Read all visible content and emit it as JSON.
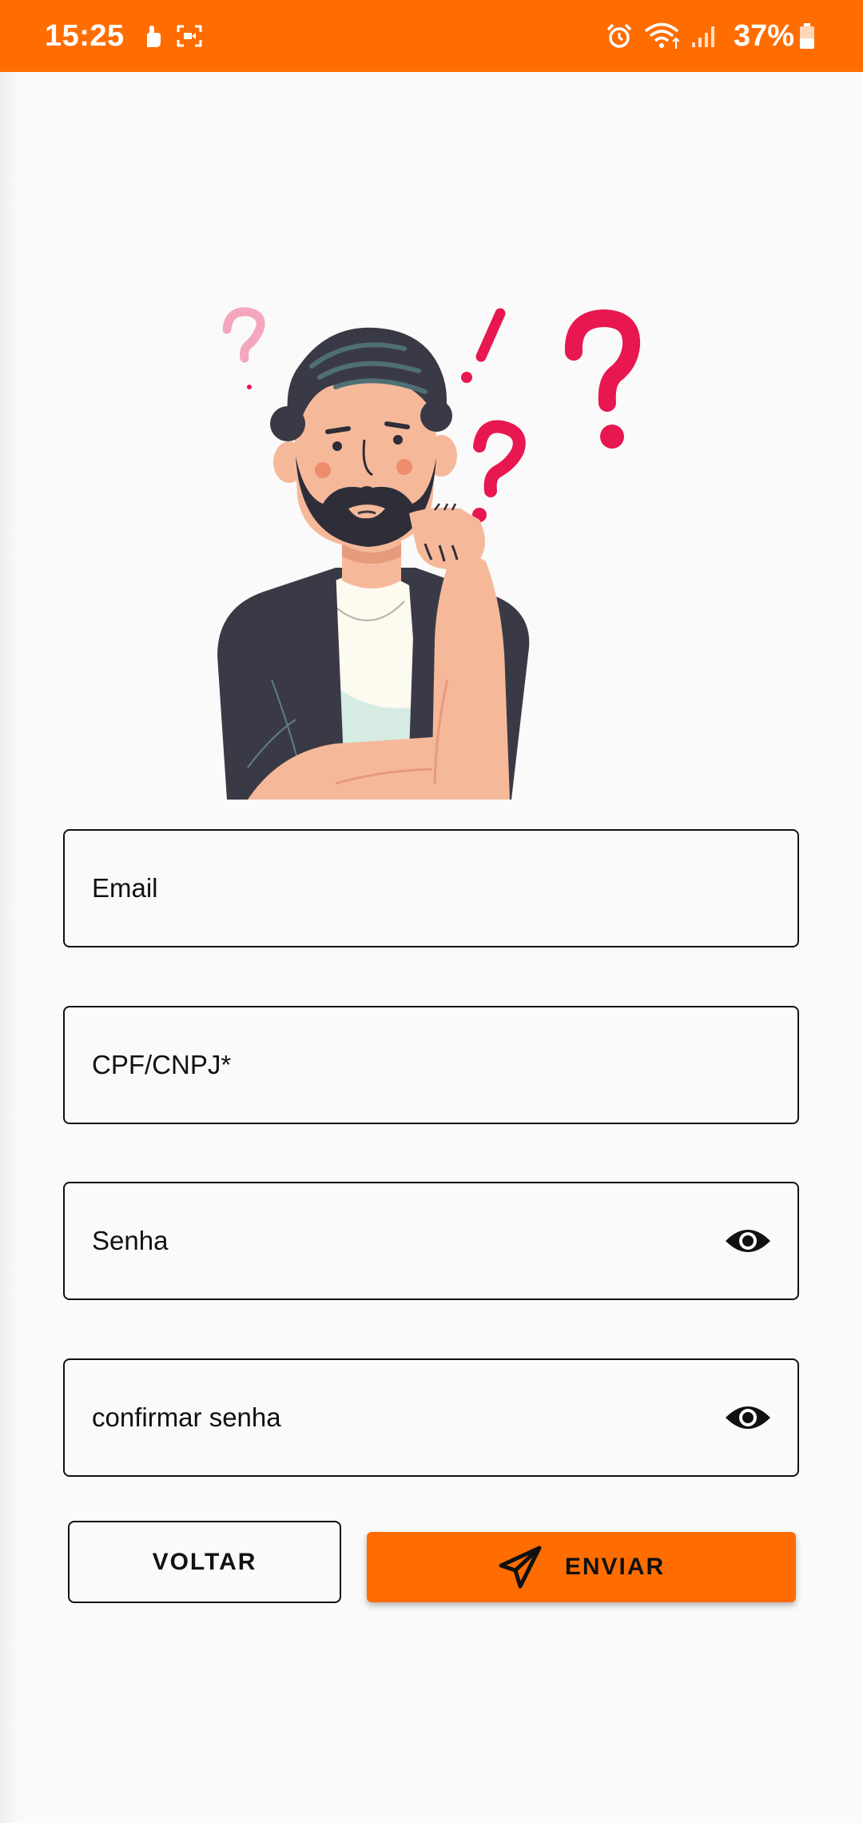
{
  "status_bar": {
    "time": "15:25",
    "battery": "37%",
    "icons": [
      "hand-icon",
      "screen-record-icon",
      "alarm-icon",
      "wifi-icon",
      "signal-icon",
      "battery-icon"
    ]
  },
  "form": {
    "email_label": "Email",
    "document_label": "CPF/CNPJ*",
    "password_label": "Senha",
    "confirm_password_label": "confirmar senha"
  },
  "actions": {
    "back_label": "VOLTAR",
    "send_label": "ENVIAR"
  },
  "colors": {
    "accent": "#ff6d00",
    "question_marks": "#e8174f",
    "background": "#fafafa"
  }
}
